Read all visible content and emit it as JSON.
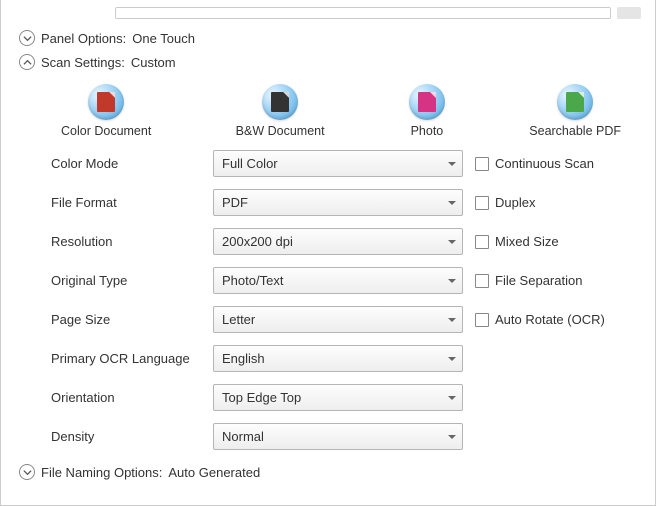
{
  "sections": {
    "panel_options": {
      "title": "Panel Options:",
      "value": "One Touch"
    },
    "scan_settings": {
      "title": "Scan Settings:",
      "value": "Custom"
    },
    "file_naming": {
      "title": "File Naming Options:",
      "value": "Auto Generated"
    }
  },
  "profiles": [
    {
      "label": "Color Document",
      "icon": "pdf-red"
    },
    {
      "label": "B&W Document",
      "icon": "pdf-gray"
    },
    {
      "label": "Photo",
      "icon": "photo-pink"
    },
    {
      "label": "Searchable PDF",
      "icon": "pdf-green"
    }
  ],
  "settings": {
    "color_mode": {
      "label": "Color Mode",
      "value": "Full Color"
    },
    "file_format": {
      "label": "File Format",
      "value": "PDF"
    },
    "resolution": {
      "label": "Resolution",
      "value": "200x200 dpi"
    },
    "original_type": {
      "label": "Original Type",
      "value": "Photo/Text"
    },
    "page_size": {
      "label": "Page Size",
      "value": "Letter"
    },
    "ocr_language": {
      "label": "Primary OCR Language",
      "value": "English"
    },
    "orientation": {
      "label": "Orientation",
      "value": "Top Edge Top"
    },
    "density": {
      "label": "Density",
      "value": "Normal"
    }
  },
  "checkboxes": {
    "continuous_scan": {
      "label": "Continuous Scan",
      "checked": false
    },
    "duplex": {
      "label": "Duplex",
      "checked": false
    },
    "mixed_size": {
      "label": "Mixed Size",
      "checked": false
    },
    "file_separation": {
      "label": "File Separation",
      "checked": false
    },
    "auto_rotate_ocr": {
      "label": "Auto Rotate (OCR)",
      "checked": false
    }
  }
}
